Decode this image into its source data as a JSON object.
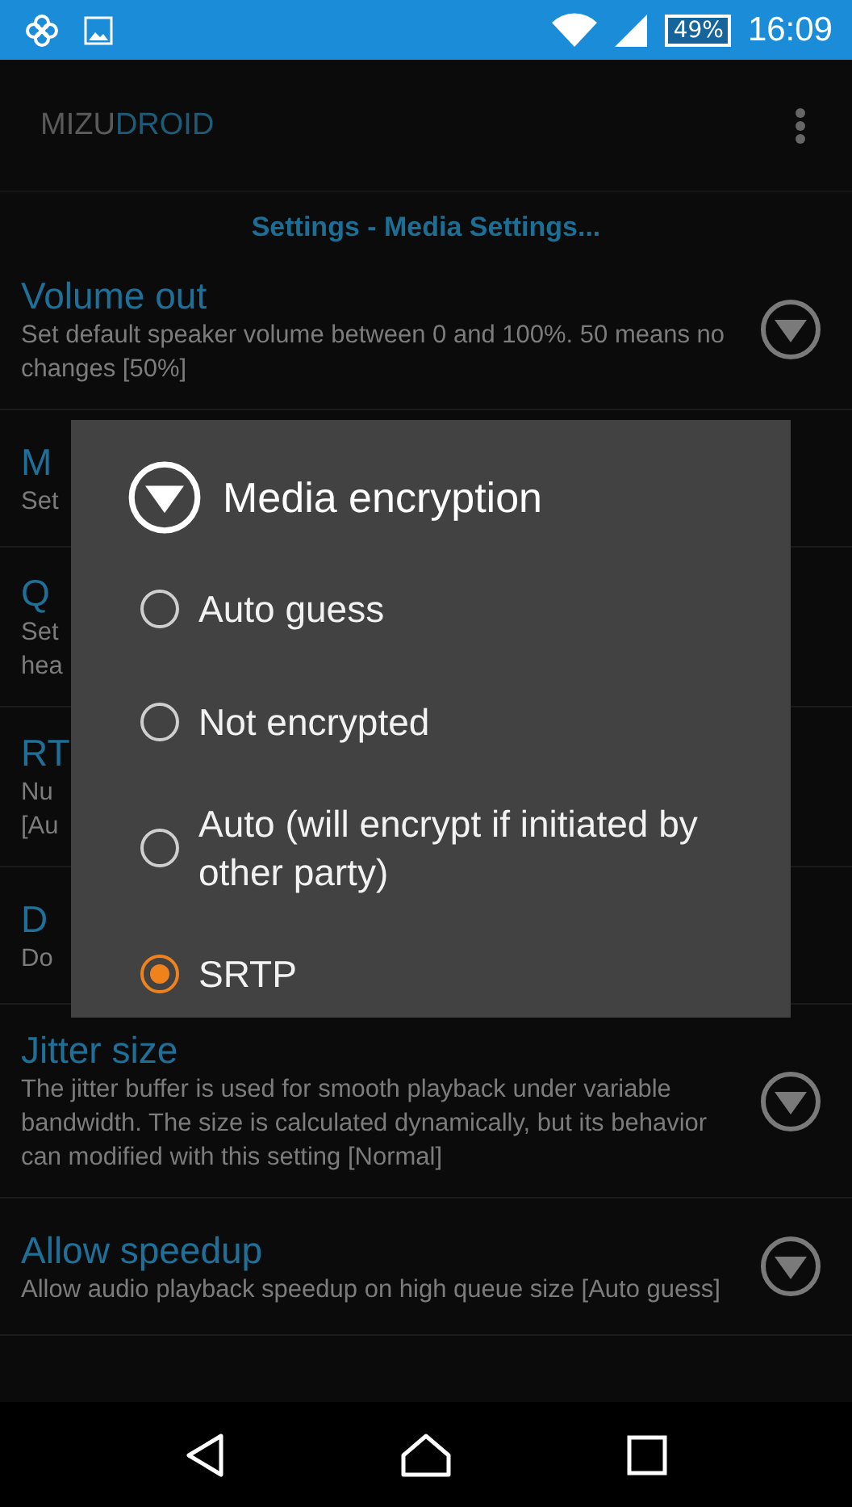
{
  "status_bar": {
    "battery": "49%",
    "time": "16:09"
  },
  "app_bar": {
    "logo_part_1": "MIZU",
    "logo_part_2": "DROID"
  },
  "section_title": "Settings - Media Settings...",
  "settings": [
    {
      "title": "Volume out",
      "summary": "Set default speaker volume between 0 and 100%. 50 means no changes [50%]",
      "dropdown_icon": true
    },
    {
      "title": "M",
      "summary": "Set",
      "dropdown_icon": false
    },
    {
      "title": "Q",
      "summary": "Set\nhea",
      "dropdown_icon": false
    },
    {
      "title": "RT",
      "summary": "Nu\n[Au",
      "dropdown_icon": false
    },
    {
      "title": "D",
      "summary": "Do",
      "dropdown_icon": false
    },
    {
      "title": "Jitter size",
      "summary": "The jitter buffer is used for smooth playback under variable bandwidth. The size is calculated dynamically, but its behavior can modified with this setting [Normal]",
      "dropdown_icon": true
    },
    {
      "title": "Allow speedup",
      "summary": "Allow audio playback speedup on high queue size [Auto guess]",
      "dropdown_icon": true
    }
  ],
  "dialog": {
    "title": "Media encryption",
    "options": [
      {
        "label": "Auto guess",
        "selected": false
      },
      {
        "label": "Not encrypted",
        "selected": false
      },
      {
        "label": "Auto (will encrypt if initiated by other party)",
        "selected": false
      },
      {
        "label": "SRTP",
        "selected": true
      }
    ]
  }
}
